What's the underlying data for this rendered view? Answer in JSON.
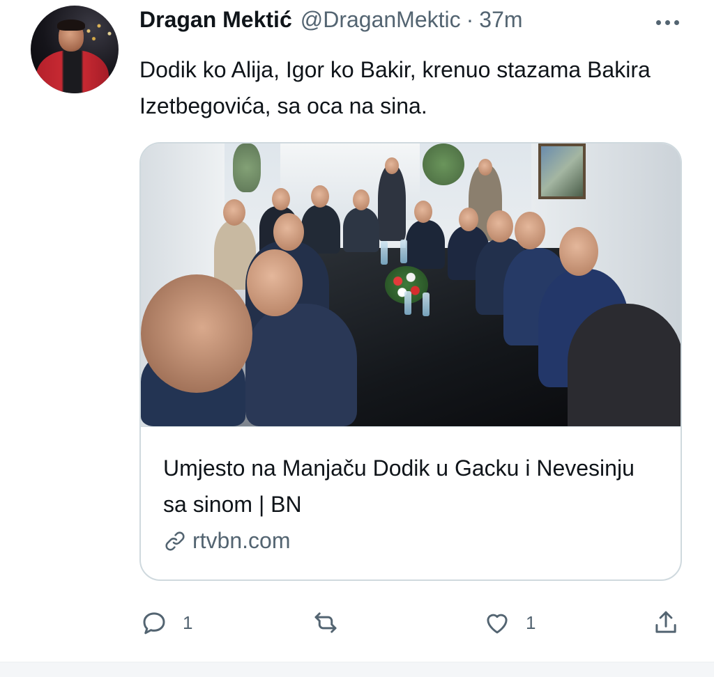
{
  "tweet": {
    "author_name": "Dragan Mektić",
    "author_handle": "@DraganMektic",
    "separator": "·",
    "timestamp": "37m",
    "text": "Dodik ko Alija, Igor ko Bakir, krenuo stazama Bakira Izetbegovića, sa oca na sina."
  },
  "card": {
    "title": "Umjesto na Manjaču Dodik u Gacku i Nevesinju sa sinom | BN",
    "domain": "rtvbn.com",
    "link_icon": "link-icon"
  },
  "actions": {
    "reply_icon": "reply-icon",
    "reply_count": "1",
    "retweet_icon": "retweet-icon",
    "like_icon": "heart-icon",
    "like_count": "1",
    "share_icon": "share-icon"
  },
  "colors": {
    "text_primary": "#0f1419",
    "text_secondary": "#536471",
    "card_border": "#cfd9de"
  }
}
